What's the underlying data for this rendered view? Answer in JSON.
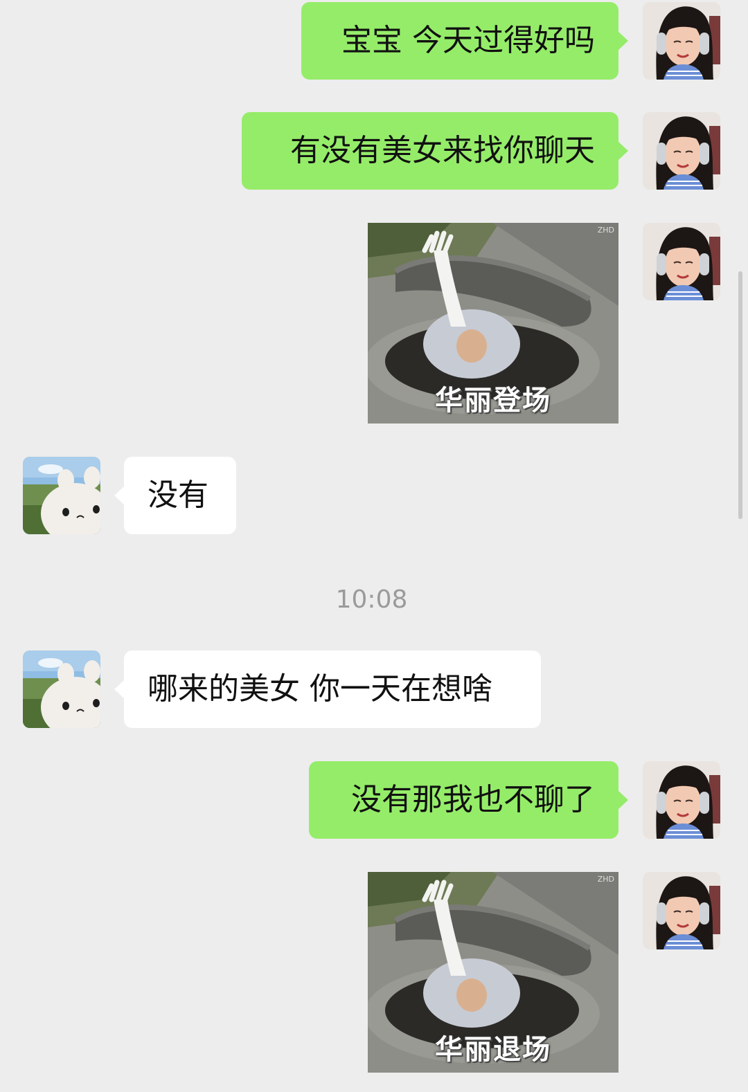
{
  "messages": [
    {
      "sender": "me",
      "type": "text",
      "text": "宝宝 今天过得好吗"
    },
    {
      "sender": "me",
      "type": "text",
      "text": "有没有美女来找你聊天"
    },
    {
      "sender": "me",
      "type": "sticker",
      "caption": "华丽登场",
      "watermark": "ZHD"
    },
    {
      "sender": "other",
      "type": "text",
      "text": "没有"
    },
    {
      "type": "timestamp",
      "text": "10:08"
    },
    {
      "sender": "other",
      "type": "text",
      "text": "哪来的美女 你一天在想啥"
    },
    {
      "sender": "me",
      "type": "text",
      "text": "没有那我也不聊了"
    },
    {
      "sender": "me",
      "type": "sticker",
      "caption": "华丽退场",
      "watermark": "ZHD"
    }
  ],
  "colors": {
    "background": "#ededed",
    "my_bubble": "#95ec69",
    "other_bubble": "#ffffff",
    "timestamp_text": "#9a9a9a"
  },
  "avatars": {
    "me": "girl-with-headphones-avatar",
    "other": "white-cat-plush-avatar"
  }
}
